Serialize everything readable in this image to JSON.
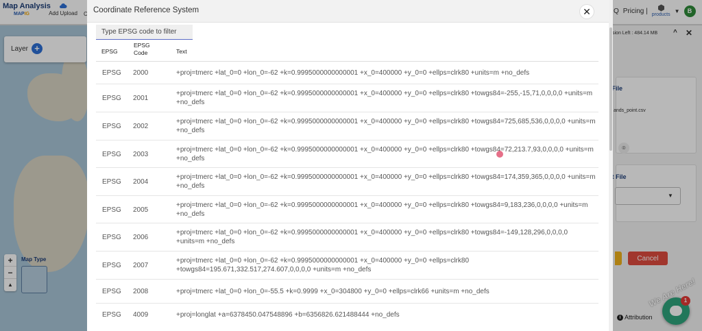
{
  "app": {
    "brand": "Map Analysis",
    "brand_sub_a": "MAP",
    "brand_sub_b": "IG",
    "add_upload": "Add Upload",
    "edge_char": "C",
    "search_char": "Q",
    "pricing": "Pricing |",
    "products": "products",
    "avatar_letter": "B",
    "layer_label": "Layer",
    "map_type_label": "Map Type",
    "session": "sion Left : 484.14 MB",
    "input_file_label": "t File",
    "file_name": "ands_point.csv",
    "output_file_label": "ut File",
    "cancel": "Cancel",
    "attribution": "Attribution",
    "chat_tagline": "We Are Here!",
    "chat_badge": "1",
    "colors": {
      "accent": "#2d6fd6",
      "cancel": "#e04b3f",
      "chat": "#2ea67d"
    }
  },
  "modal": {
    "title": "Coordinate Reference System",
    "close": "✕",
    "filter_placeholder": "Type EPSG code to filter",
    "columns": [
      "EPSG",
      "EPSG Code",
      "Text"
    ],
    "rows": [
      {
        "auth": "EPSG",
        "code": "2000",
        "text": "+proj=tmerc +lat_0=0 +lon_0=-62 +k=0.9995000000000001 +x_0=400000 +y_0=0 +ellps=clrk80 +units=m +no_defs"
      },
      {
        "auth": "EPSG",
        "code": "2001",
        "text": "+proj=tmerc +lat_0=0 +lon_0=-62 +k=0.9995000000000001 +x_0=400000 +y_0=0 +ellps=clrk80 +towgs84=-255,-15,71,0,0,0,0 +units=m +no_defs"
      },
      {
        "auth": "EPSG",
        "code": "2002",
        "text": "+proj=tmerc +lat_0=0 +lon_0=-62 +k=0.9995000000000001 +x_0=400000 +y_0=0 +ellps=clrk80 +towgs84=725,685,536,0,0,0,0 +units=m +no_defs"
      },
      {
        "auth": "EPSG",
        "code": "2003",
        "text": "+proj=tmerc +lat_0=0 +lon_0=-62 +k=0.9995000000000001 +x_0=400000 +y_0=0 +ellps=clrk80 +towgs84=72,213.7,93,0,0,0,0 +units=m +no_defs"
      },
      {
        "auth": "EPSG",
        "code": "2004",
        "text": "+proj=tmerc +lat_0=0 +lon_0=-62 +k=0.9995000000000001 +x_0=400000 +y_0=0 +ellps=clrk80 +towgs84=174,359,365,0,0,0,0 +units=m +no_defs"
      },
      {
        "auth": "EPSG",
        "code": "2005",
        "text": "+proj=tmerc +lat_0=0 +lon_0=-62 +k=0.9995000000000001 +x_0=400000 +y_0=0 +ellps=clrk80 +towgs84=9,183,236,0,0,0,0 +units=m +no_defs"
      },
      {
        "auth": "EPSG",
        "code": "2006",
        "text": "+proj=tmerc +lat_0=0 +lon_0=-62 +k=0.9995000000000001 +x_0=400000 +y_0=0 +ellps=clrk80 +towgs84=-149,128,296,0,0,0,0 +units=m +no_defs"
      },
      {
        "auth": "EPSG",
        "code": "2007",
        "text": "+proj=tmerc +lat_0=0 +lon_0=-62 +k=0.9995000000000001 +x_0=400000 +y_0=0 +ellps=clrk80 +towgs84=195.671,332.517,274.607,0,0,0,0 +units=m +no_defs"
      },
      {
        "auth": "EPSG",
        "code": "2008",
        "text": "+proj=tmerc +lat_0=0 +lon_0=-55.5 +k=0.9999 +x_0=304800 +y_0=0 +ellps=clrk66 +units=m +no_defs"
      },
      {
        "auth": "EPSG",
        "code": "4009",
        "text": "+proj=longlat +a=6378450.047548896 +b=6356826.621488444 +no_defs"
      }
    ]
  }
}
